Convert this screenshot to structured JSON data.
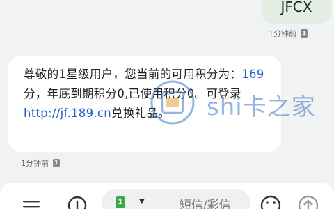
{
  "outgoing": {
    "text": "JFCX",
    "time": "1分钟前",
    "sim_label": "1"
  },
  "incoming": {
    "text_part1": "尊敬的1星级用户，您当前的可用积分为：",
    "points_link": "169",
    "text_part2": "分，年底到期积分0,已使用积分0。可登录",
    "url_link": "http://jf.189.cn",
    "text_part3": "兑换礼品。",
    "time": "1分钟前",
    "sim_label": "1"
  },
  "watermark": {
    "text": "shi卡之家"
  },
  "composer": {
    "placeholder": "短信/彩信",
    "sim_label": "1"
  },
  "colors": {
    "link": "#1e5fd0",
    "outgoing_bubble": "#e4ede4",
    "sim_green": "#3aa84a"
  },
  "icons": [
    "menu-icon",
    "add-icon",
    "sim-selector-icon",
    "emoji-icon",
    "send-icon"
  ]
}
